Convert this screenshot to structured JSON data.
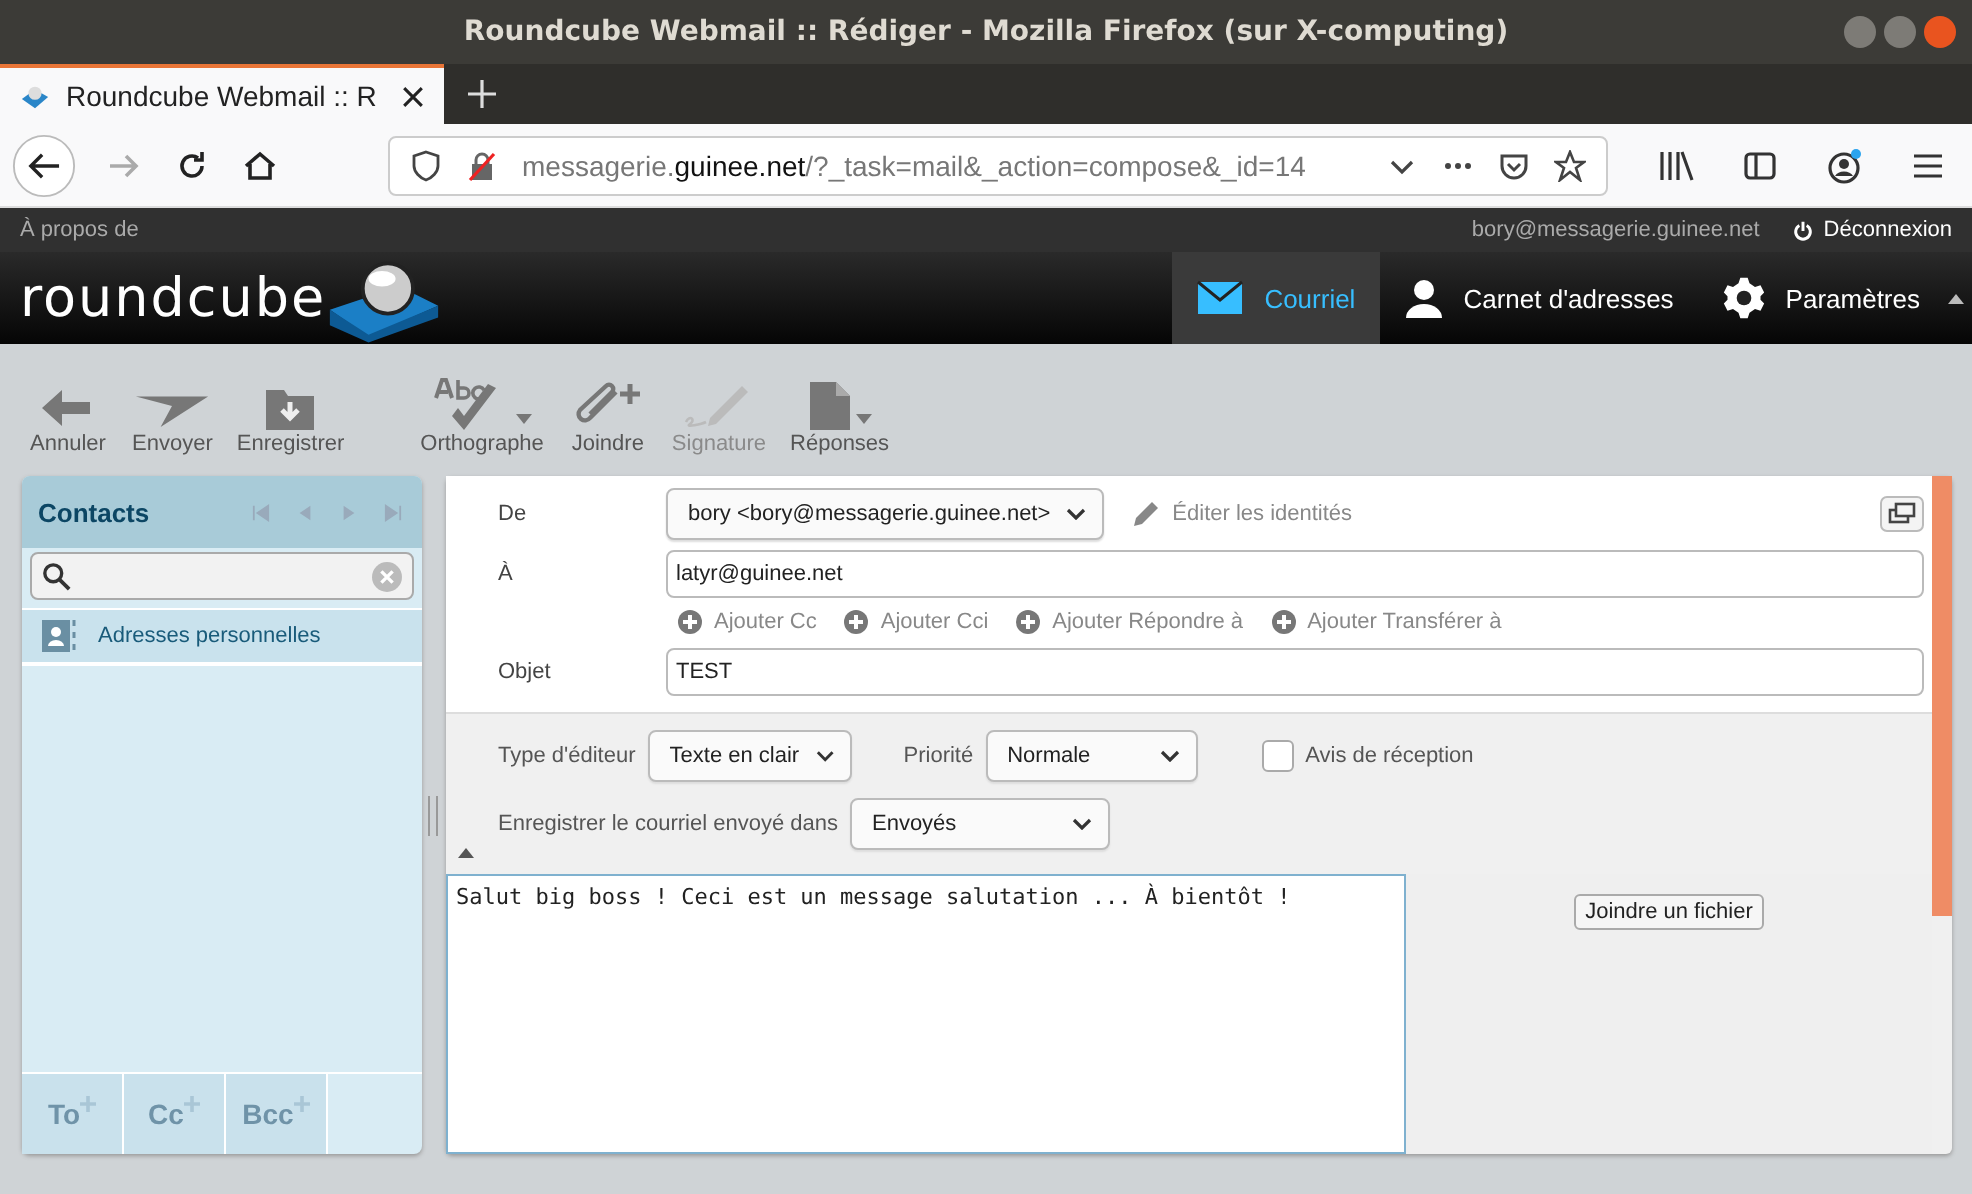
{
  "window": {
    "title": "Roundcube Webmail :: Rédiger - Mozilla Firefox (sur X-computing)"
  },
  "browser": {
    "tab_title": "Roundcube Webmail :: R",
    "url_start": "messagerie.",
    "url_domain": "guinee.net",
    "url_rest": "/?_task=mail&_action=compose&_id=14"
  },
  "top_bar": {
    "about": "À propos de",
    "user": "bory@messagerie.guinee.net",
    "logout": "Déconnexion"
  },
  "header": {
    "logo": "roundcube",
    "nav": [
      {
        "label": "Courriel",
        "selected": true,
        "kind": "mail"
      },
      {
        "label": "Carnet d'adresses",
        "selected": false,
        "kind": "person"
      },
      {
        "label": "Paramètres",
        "selected": false,
        "kind": "gear"
      }
    ]
  },
  "toolbar": [
    {
      "label": "Annuler",
      "kind": "back",
      "disabled": false,
      "dropdown": false
    },
    {
      "label": "Envoyer",
      "kind": "send",
      "disabled": false,
      "dropdown": false
    },
    {
      "label": "Enregistrer",
      "kind": "save",
      "disabled": false,
      "dropdown": false
    },
    {
      "label": "Orthographe",
      "kind": "spell",
      "disabled": false,
      "dropdown": true
    },
    {
      "label": "Joindre",
      "kind": "clip",
      "disabled": false,
      "dropdown": false
    },
    {
      "label": "Signature",
      "kind": "sign",
      "disabled": true,
      "dropdown": false
    },
    {
      "label": "Réponses",
      "kind": "doc",
      "disabled": false,
      "dropdown": true
    }
  ],
  "contacts": {
    "title": "Contacts",
    "groups": [
      {
        "label": "Adresses personnelles"
      }
    ],
    "footer": [
      "To",
      "Cc",
      "Bcc"
    ]
  },
  "compose": {
    "from_label": "De",
    "from_value": "bory <bory@messagerie.guinee.net>",
    "edit_identities": "Éditer les identités",
    "to_label": "À",
    "to_value": "latyr@guinee.net",
    "add_links": [
      "Ajouter Cc",
      "Ajouter Cci",
      "Ajouter Répondre à",
      "Ajouter Transférer à"
    ],
    "subject_label": "Objet",
    "subject_value": "TEST",
    "editor_label": "Type d'éditeur",
    "editor_value": "Texte en clair",
    "priority_label": "Priorité",
    "priority_value": "Normale",
    "receipt_label": "Avis de réception",
    "receipt_checked": false,
    "save_label": "Enregistrer le courriel envoyé dans",
    "save_value": "Envoyés",
    "body": "Salut big boss ! Ceci est un message salutation ... À bientôt !",
    "attach_button": "Joindre un fichier"
  }
}
